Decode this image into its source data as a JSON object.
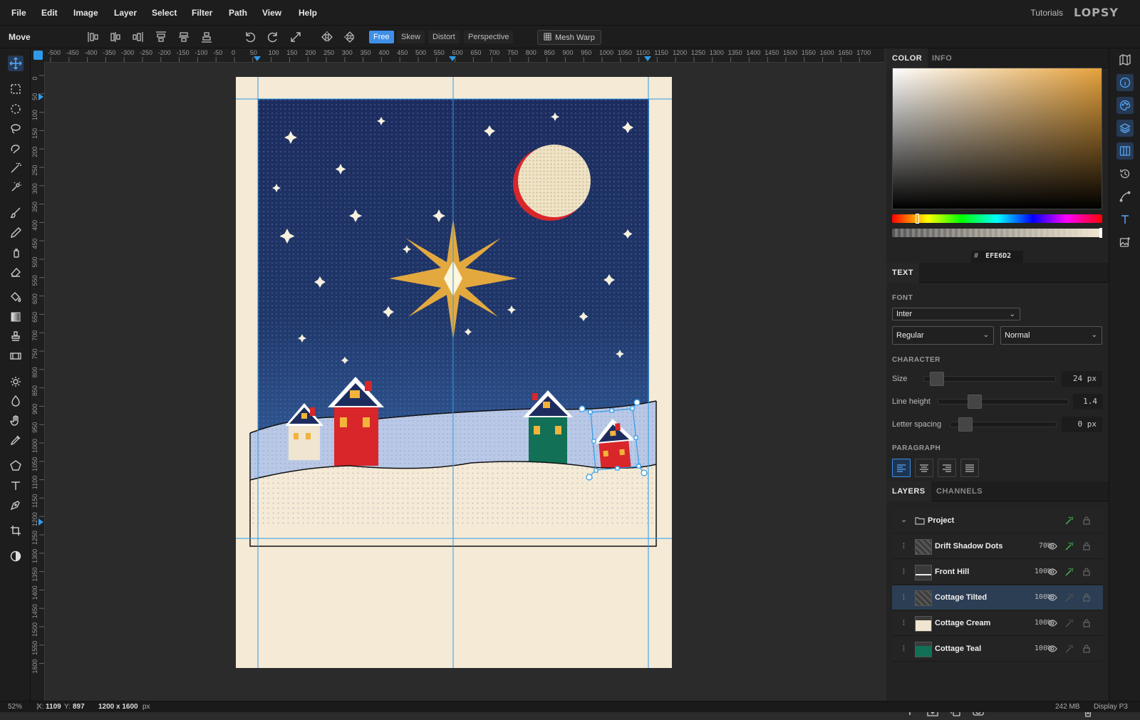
{
  "menu": [
    "File",
    "Edit",
    "Image",
    "Layer",
    "Select",
    "Filter",
    "Path",
    "View",
    "Help"
  ],
  "header": {
    "tutorials": "Tutorials",
    "logo": "LOPSY"
  },
  "options": {
    "tool_name": "Move",
    "transform_modes": [
      "Free",
      "Skew",
      "Distort",
      "Perspective"
    ],
    "active_mode": "Free",
    "mesh_warp": "Mesh Warp"
  },
  "rulers": {
    "h_labels": [
      "-500",
      "-450",
      "-400",
      "-350",
      "-300",
      "-250",
      "-200",
      "-150",
      "-100",
      "-50",
      "0",
      "50",
      "100",
      "150",
      "200",
      "250",
      "300",
      "350",
      "400",
      "450",
      "500",
      "550",
      "600",
      "650",
      "700",
      "750",
      "800",
      "850",
      "900",
      "950",
      "1000",
      "1050",
      "1100",
      "1150",
      "1200",
      "1250",
      "1300",
      "1350",
      "1400",
      "1450",
      "1500",
      "1550",
      "1600",
      "1650",
      "1700"
    ],
    "v_labels": [
      "0",
      "50",
      "100",
      "150",
      "200",
      "250",
      "300",
      "350",
      "400",
      "450",
      "500",
      "550",
      "600",
      "650",
      "700",
      "750",
      "800",
      "850",
      "900",
      "950",
      "1000",
      "1050",
      "1100",
      "1150",
      "1200",
      "1250",
      "1300",
      "1350",
      "1400",
      "1450",
      "1500",
      "1550",
      "1600"
    ]
  },
  "color_panel": {
    "tabs": [
      "COLOR",
      "INFO"
    ],
    "active_tab": "COLOR",
    "hex_label": "#",
    "hex": "EFE6D2",
    "base_hue": "#e6a23c"
  },
  "text_panel": {
    "title": "TEXT",
    "font_label": "FONT",
    "font": "Inter",
    "weight": "Regular",
    "style": "Normal",
    "character_label": "CHARACTER",
    "size_label": "Size",
    "size_value": "24 px",
    "line_height_label": "Line height",
    "line_height_value": "1.4",
    "letter_spacing_label": "Letter spacing",
    "letter_spacing_value": "0 px",
    "paragraph_label": "PARAGRAPH"
  },
  "layers_panel": {
    "tabs": [
      "LAYERS",
      "CHANNELS"
    ],
    "active_tab": "LAYERS",
    "group": "Project",
    "layers": [
      {
        "name": "Drift Shadow Dots",
        "opacity": "70%"
      },
      {
        "name": "Front Hill",
        "opacity": "100%"
      },
      {
        "name": "Cottage Tilted",
        "opacity": "100%"
      },
      {
        "name": "Cottage Cream",
        "opacity": "100%"
      },
      {
        "name": "Cottage Teal",
        "opacity": "100%"
      }
    ],
    "selected": "Cottage Tilted"
  },
  "status": {
    "zoom": "52%",
    "x_label": "X:",
    "x": "1109",
    "y_label": "Y:",
    "y": "897",
    "doc_size": "1200 x 1600",
    "doc_unit": "px",
    "memory": "242 MB",
    "color_profile": "Display P3"
  }
}
